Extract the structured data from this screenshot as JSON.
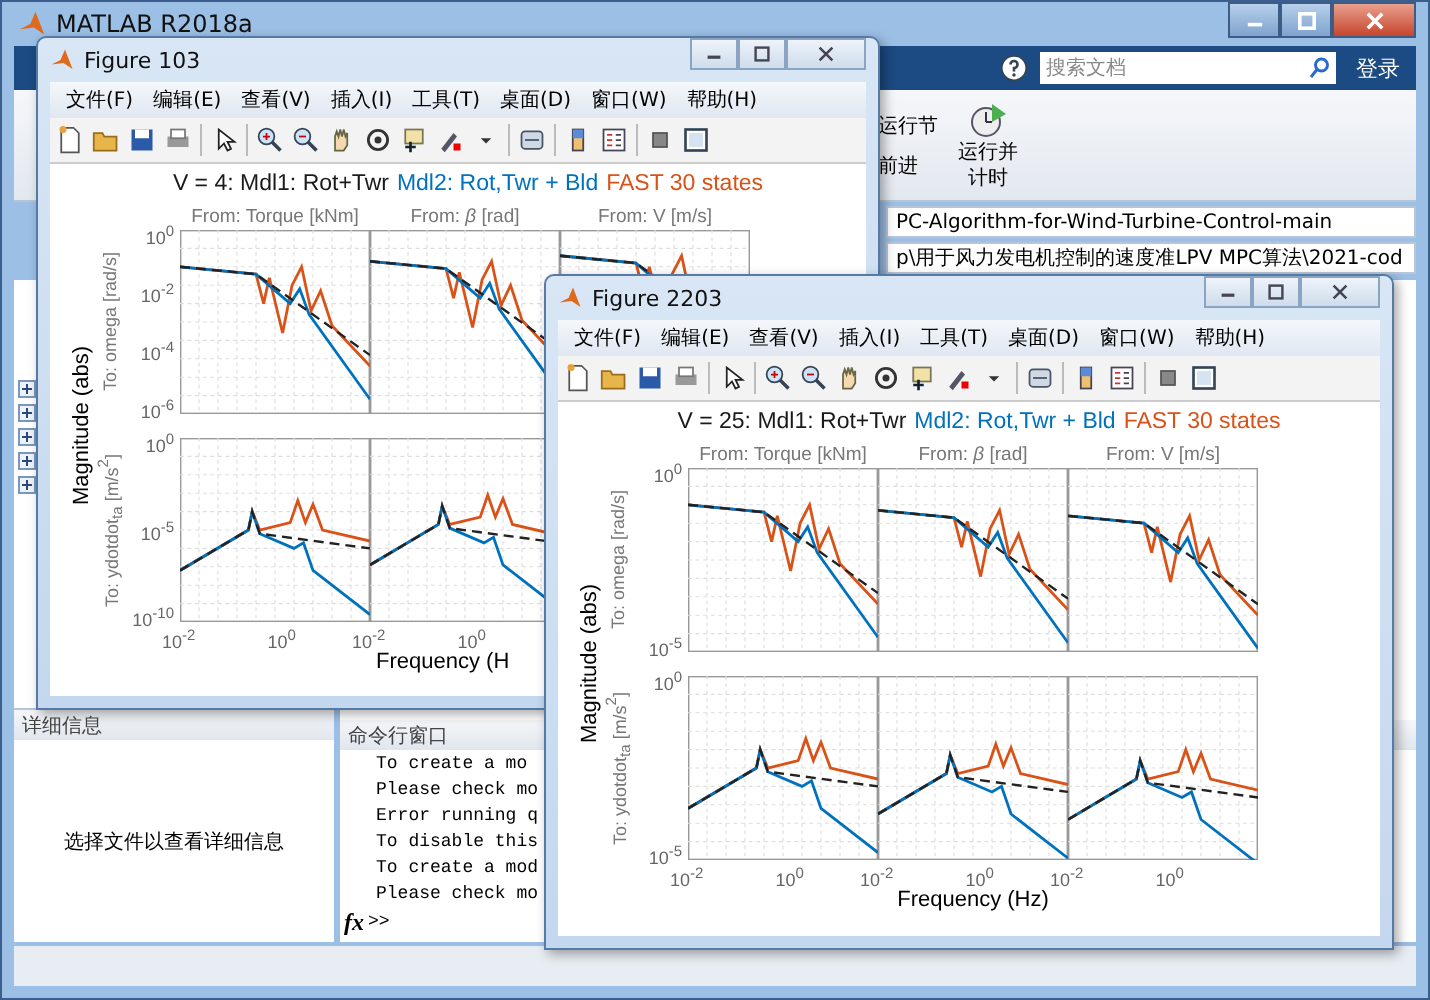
{
  "main_window": {
    "title": "MATLAB R2018a",
    "search": {
      "placeholder": "搜索文档"
    },
    "login_button": "登录",
    "small_buttons": [
      "运行节",
      "前进"
    ],
    "big_button": {
      "lines": [
        "运行并",
        "计时"
      ]
    },
    "address_bar": "PC-Algorithm-for-Wind-Turbine-Control-main",
    "current_folder": "p\\用于风力发电机控制的速度准LPV MPC算法\\2021-cod",
    "details_panel": {
      "title": "详细信息",
      "message": "选择文件以查看详细信息"
    },
    "command_window": {
      "title": "命令行窗口",
      "lines": [
        "To create a mo",
        "Please check mo",
        "Error running q",
        "To disable this",
        "To create a mod",
        "Please check mo"
      ],
      "prompt_icon": "fx",
      "prompt": ">>"
    }
  },
  "figures": [
    {
      "window_title": "Figure 103",
      "menu": [
        "文件(F)",
        "编辑(E)",
        "查看(V)",
        "插入(I)",
        "工具(T)",
        "桌面(D)",
        "窗口(W)",
        "帮助(H)"
      ],
      "title_parts": [
        {
          "text": "V = 4: Mdl1: Rot+Twr",
          "color": "#1a1a1a"
        },
        {
          "text": "Mdl2: Rot,Twr + Bld",
          "color": "#0072bd"
        },
        {
          "text": "FAST 30 states",
          "color": "#d95319"
        }
      ],
      "columns": [
        {
          "title": "From: Torque [kNm]",
          "xticks": [
            "10$^{-2}$",
            "10$^{0}$"
          ]
        },
        {
          "title": "From: *β* [rad]",
          "xticks": [
            "10$^{-2}$",
            "10$^{0}$"
          ]
        },
        {
          "title": "From: V [m/s]"
        }
      ],
      "rows": [
        {
          "label": "To: omega [rad/s]",
          "yticks": [
            "10$^{0}$",
            "10$^{-2}$",
            "10$^{-4}$",
            "10$^{-6}$"
          ]
        },
        {
          "label": "To: ydotdot$_{ta}$ [m/s$^{2}$]",
          "yticks": [
            "10$^{0}$",
            "10$^{-5}$",
            "10$^{-10}$"
          ]
        }
      ],
      "xlabel": "Frequency  (H",
      "ylabel": "Magnitude (abs)"
    },
    {
      "window_title": "Figure 2203",
      "menu": [
        "文件(F)",
        "编辑(E)",
        "查看(V)",
        "插入(I)",
        "工具(T)",
        "桌面(D)",
        "窗口(W)",
        "帮助(H)"
      ],
      "title_parts": [
        {
          "text": "V = 25: Mdl1: Rot+Twr",
          "color": "#1a1a1a"
        },
        {
          "text": "Mdl2: Rot,Twr + Bld",
          "color": "#0072bd"
        },
        {
          "text": "FAST 30 states",
          "color": "#d95319"
        }
      ],
      "columns": [
        {
          "title": "From: Torque [kNm]",
          "xticks": [
            "10$^{-2}$",
            "10$^{0}$"
          ]
        },
        {
          "title": "From: *β* [rad]",
          "xticks": [
            "10$^{-2}$",
            "10$^{0}$"
          ]
        },
        {
          "title": "From: V [m/s]",
          "xticks": [
            "10$^{-2}$",
            "10$^{0}$"
          ]
        }
      ],
      "rows": [
        {
          "label": "To: omega [rad/s]",
          "yticks": [
            "10$^{0}$",
            "10$^{-5}$"
          ]
        },
        {
          "label": "To: ydotdot$_{ta}$ [m/s$^{2}$]",
          "yticks": [
            "10$^{0}$",
            "10$^{-5}$"
          ]
        }
      ],
      "xlabel": "Frequency  (Hz)",
      "ylabel": "Magnitude (abs)"
    }
  ]
}
